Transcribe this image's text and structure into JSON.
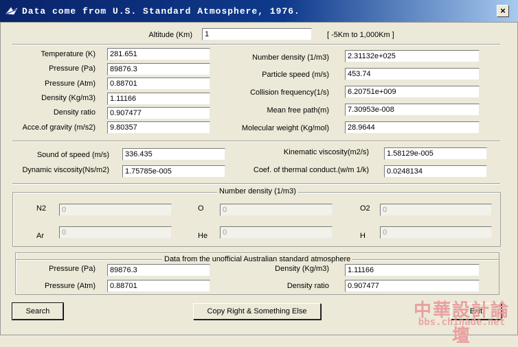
{
  "window": {
    "title": "Data come from U.S. Standard Atmosphere, 1976.",
    "close_glyph": "×"
  },
  "altitude": {
    "label": "Altitude (Km)",
    "value": "1",
    "range_note": "[ -5Km to 1,000Km ]"
  },
  "left_block": [
    {
      "label": "Temperature (K)",
      "value": "281.651"
    },
    {
      "label": "Pressure (Pa)",
      "value": "89876.3"
    },
    {
      "label": "Pressure (Atm)",
      "value": "0.88701"
    },
    {
      "label": "Density (Kg/m3)",
      "value": "1.11166"
    },
    {
      "label": "Density ratio",
      "value": "0.907477"
    },
    {
      "label": "Acce.of gravity (m/s2)",
      "value": "9.80357"
    }
  ],
  "right_block": [
    {
      "label": "Number density (1/m3)",
      "value": "2.31132e+025"
    },
    {
      "label": "Particle speed (m/s)",
      "value": "453.74"
    },
    {
      "label": "Collision frequency(1/s)",
      "value": "6.20751e+009"
    },
    {
      "label": "Mean free path(m)",
      "value": "7.30953e-008"
    },
    {
      "label": "Molecular weight (Kg/mol)",
      "value": "28.9644"
    }
  ],
  "viscosity": {
    "sound_speed": {
      "label": "Sound of speed (m/s)",
      "value": "336.435"
    },
    "dynamic": {
      "label": "Dynamic viscosity(Ns/m2)",
      "value": "1.75785e-005"
    },
    "kinematic": {
      "label": "Kinematic viscosity(m2/s)",
      "value": "1.58129e-005"
    },
    "thermal": {
      "label": "Coef. of thermal conduct.(w/m 1/k)",
      "value": "0.0248134"
    }
  },
  "number_density": {
    "title": "Number density (1/m3)",
    "species": [
      {
        "label": "N2",
        "value": "0"
      },
      {
        "label": "O",
        "value": "0"
      },
      {
        "label": "O2",
        "value": "0"
      },
      {
        "label": "Ar",
        "value": "0"
      },
      {
        "label": "He",
        "value": "0"
      },
      {
        "label": "H",
        "value": "0"
      }
    ]
  },
  "australian": {
    "title": "Data from the unofficial Australian standard atmosphere",
    "pressure_pa": {
      "label": "Pressure (Pa)",
      "value": "89876.3"
    },
    "pressure_atm": {
      "label": "Pressure (Atm)",
      "value": "0.88701"
    },
    "density": {
      "label": "Density (Kg/m3)",
      "value": "1.11166"
    },
    "density_ratio": {
      "label": "Density ratio",
      "value": "0.907477"
    }
  },
  "buttons": {
    "search": "Search",
    "copyright": "Copy Right  &  Something  Else",
    "exit": "Exit"
  },
  "watermark": {
    "cn": "中華設計論壇",
    "url": "bbs.chinade.net"
  },
  "colors": {
    "titlebar": "#0a246a",
    "face": "#ece9d8"
  }
}
